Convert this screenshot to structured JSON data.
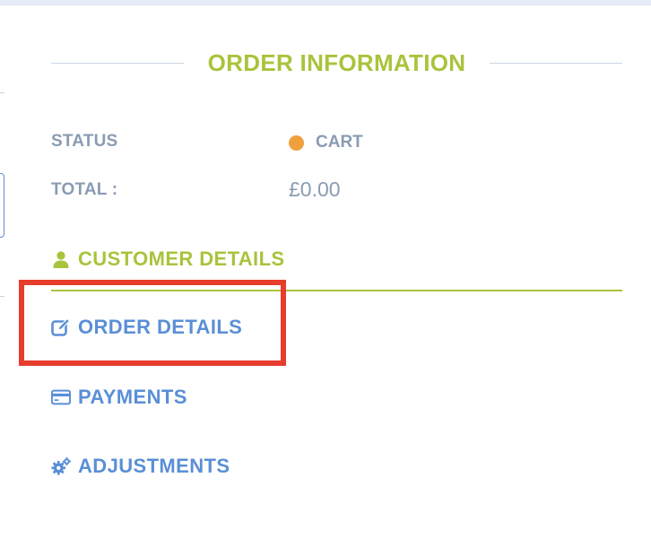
{
  "order_info": {
    "title": "ORDER INFORMATION",
    "status_label": "STATUS",
    "status_value": "CART",
    "status_color": "#f0a03c",
    "total_label": "TOTAL :",
    "total_value": "£0.00"
  },
  "nav": {
    "customer_details": {
      "label": "CUSTOMER DETAILS",
      "icon": "user-icon",
      "active": true
    },
    "order_details": {
      "label": "ORDER DETAILS",
      "icon": "edit-icon",
      "highlighted": true
    },
    "payments": {
      "label": "PAYMENTS",
      "icon": "credit-card-icon"
    },
    "adjustments": {
      "label": "ADJUSTMENTS",
      "icon": "cogs-icon"
    }
  },
  "colors": {
    "accent_green": "#a7c43c",
    "link_blue": "#5a8fd6",
    "label_gray": "#8a9cb2",
    "highlight_red": "#e63d2d"
  }
}
